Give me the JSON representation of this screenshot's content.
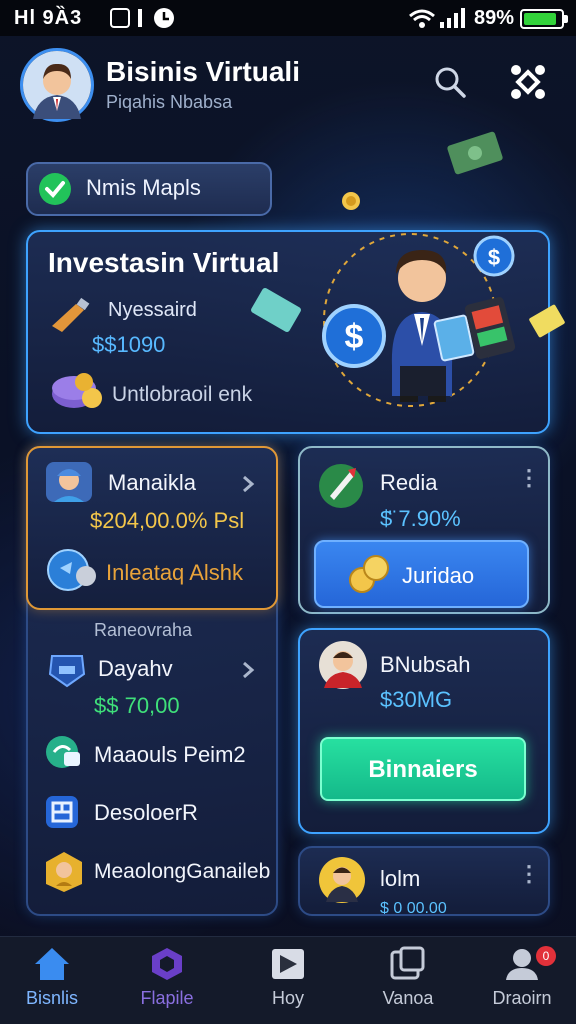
{
  "status_bar": {
    "time": "Hl 9Ȁ3",
    "battery_text": "89%"
  },
  "header": {
    "title": "Bisinis Virtuali",
    "subtitle": "Piqahis Nbabsa",
    "search_icon": "search-icon",
    "menu_icon": "network-icon"
  },
  "status_pill": {
    "label": "Nmis Mapls",
    "icon": "check-circle-icon"
  },
  "hero": {
    "title": "Investasin Virtual",
    "row1_label": "Nyessaird",
    "row1_value": "$$1090",
    "row2_label": "Untlobraoil enk"
  },
  "left_panel": {
    "top": {
      "name": "Manaikla",
      "value": "$204,00.0% Psl",
      "link": "Inleataq Alshk"
    },
    "section_label": "Raneovraha",
    "items": [
      {
        "label": "Dayahv",
        "value": "$$ 70,00"
      },
      {
        "label": "Maaouls Peim2"
      },
      {
        "label": "DesoloerR"
      },
      {
        "label": "MeaolongGanaileb"
      }
    ]
  },
  "right_cards": [
    {
      "name": "Redia",
      "value": "$̈ 7.90%",
      "button": "Juridao"
    },
    {
      "name": "BNubsah",
      "value": "$30MG",
      "button": "Binnaiers"
    },
    {
      "name": "lolm",
      "value": "$ 0 00.00"
    }
  ],
  "nav": [
    {
      "label": "Bisnlis",
      "icon": "home-icon",
      "active": true
    },
    {
      "label": "Flapile",
      "icon": "cube-icon",
      "active": false
    },
    {
      "label": "Hoy",
      "icon": "play-icon",
      "active": false
    },
    {
      "label": "Vanoa",
      "icon": "window-icon",
      "active": false
    },
    {
      "label": "Draoirn",
      "icon": "profile-icon",
      "active": false
    }
  ],
  "nav_badge": "0",
  "colors": {
    "accent": "#3ea3ff",
    "green": "#3fe07a",
    "gold": "#f3c64a",
    "orange": "#e09836"
  }
}
